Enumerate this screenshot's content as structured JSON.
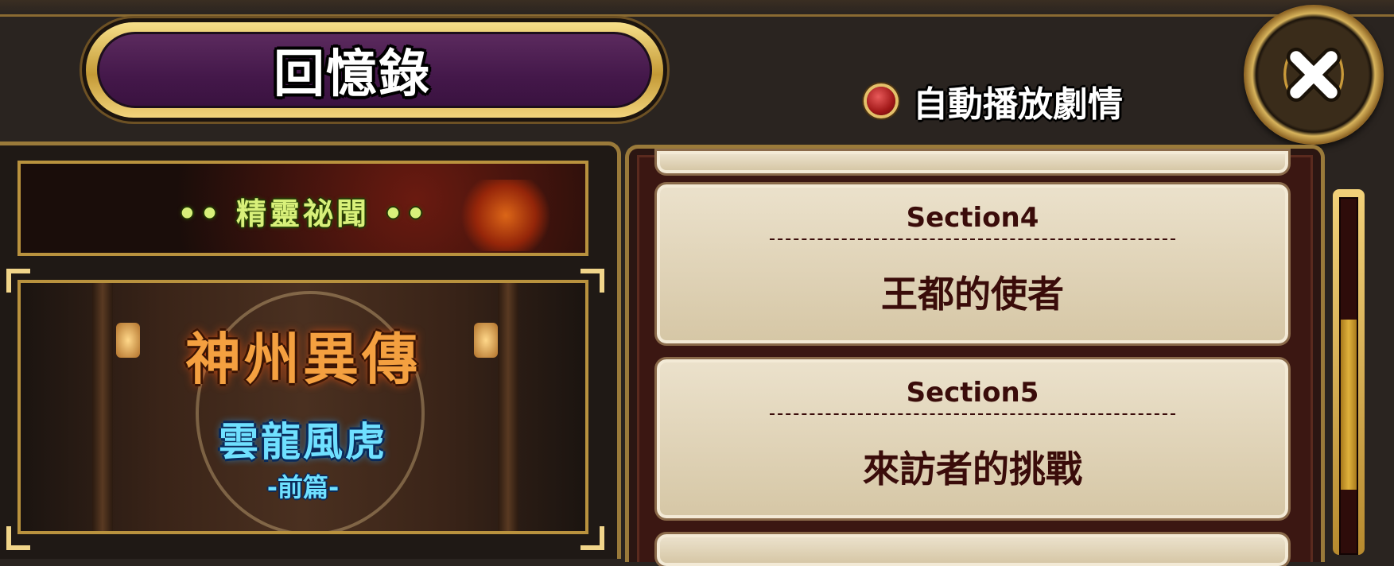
{
  "header": {
    "title": "回憶錄",
    "autoplay_label": "自動播放劇情",
    "close_icon": "close-x-icon"
  },
  "chapters": [
    {
      "label": "•• 精靈祕聞 ••"
    },
    {
      "title": "神州異傳",
      "subtitle": "雲龍風虎",
      "part": "-前篇-"
    }
  ],
  "sections": [
    {
      "head": "Section4",
      "title": "王都的使者"
    },
    {
      "head": "Section5",
      "title": "來訪者的挑戰"
    }
  ],
  "colors": {
    "accent_gold": "#c49a36",
    "title_purple": "#44184a",
    "card_text": "#3a0c0a",
    "radio_red": "#a11818"
  },
  "scroll": {
    "position_fraction": 0.34
  }
}
